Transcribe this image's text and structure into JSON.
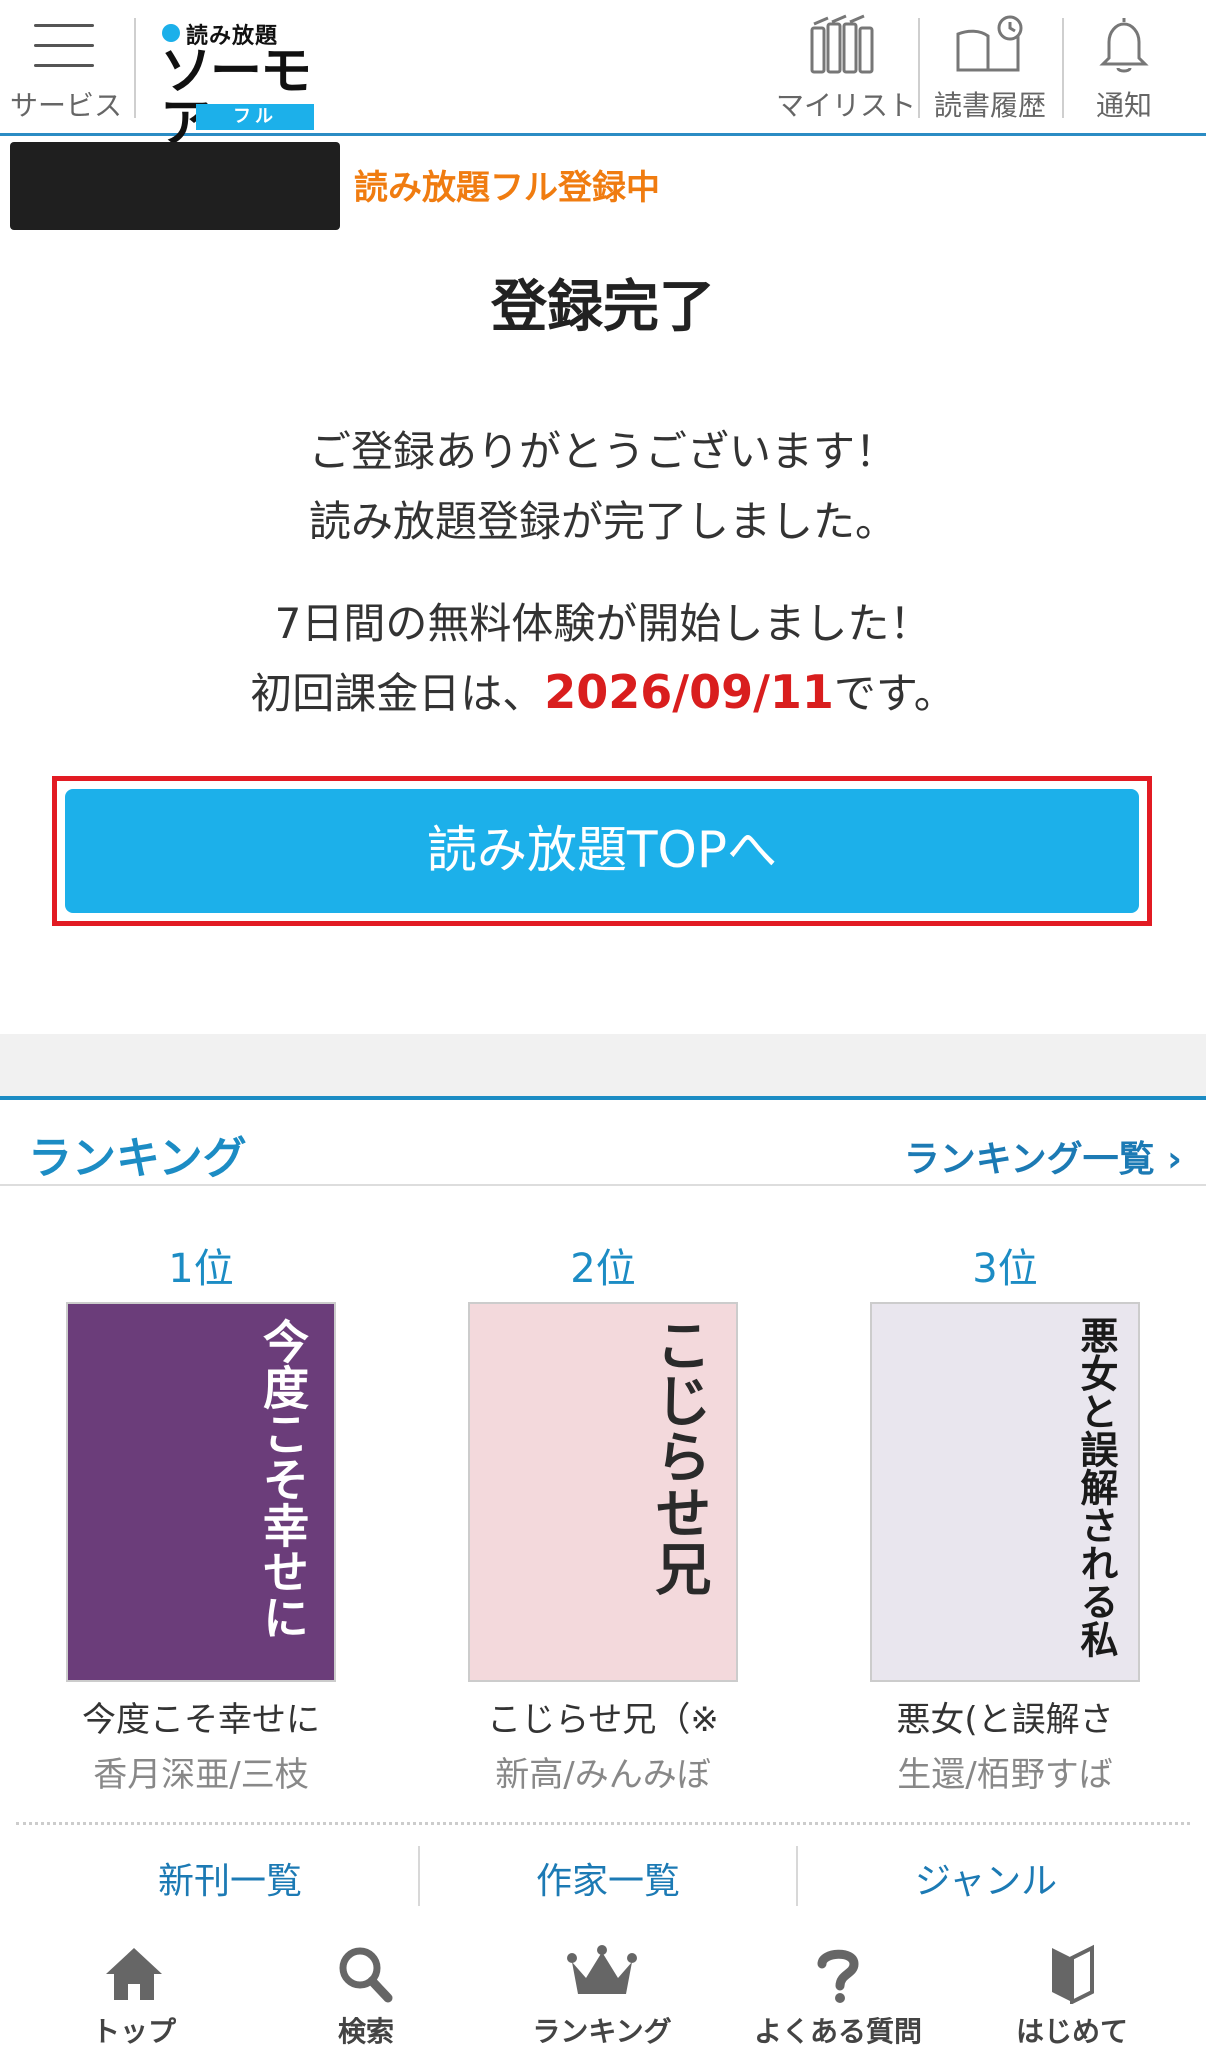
{
  "header": {
    "menu_label": "サービス",
    "logo_sub": "読み放題",
    "logo_main": "ソーモア",
    "logo_pill": "フル",
    "mylist_label": "マイリスト",
    "history_label": "読書履歴",
    "notify_label": "通知"
  },
  "status_text": "読み放題フル登録中",
  "completion": {
    "title": "登録完了",
    "thanks_line1": "ご登録ありがとうございます！",
    "thanks_line2": "読み放題登録が完了しました。",
    "trial_line": "7日間の無料体験が開始しました！",
    "billing_prefix": "初回課金日は、",
    "billing_date": "2026/09/11",
    "billing_suffix": "です。",
    "cta_label": "読み放題TOPへ"
  },
  "ranking": {
    "heading": "ランキング",
    "more_link": "ランキング一覧 ›",
    "items": [
      {
        "rank": "1位",
        "title": "今度こそ幸せに",
        "author": "香月深亜/三枝",
        "cover_text": "今度こそ幸せに",
        "cover_bg": "#6b3d7a",
        "cover_fg": "#ffffff"
      },
      {
        "rank": "2位",
        "title": "こじらせ兄（※",
        "author": "新高/みんみぼ",
        "cover_text": "こじらせ兄",
        "cover_bg": "#f3d9dc",
        "cover_fg": "#2a2a2a"
      },
      {
        "rank": "3位",
        "title": "悪女(と誤解さ",
        "author": "生還/栢野すば",
        "cover_text": "悪女と誤解される私",
        "cover_bg": "#e9e6ee",
        "cover_fg": "#1a1a1a"
      }
    ]
  },
  "sublinks": [
    "新刊一覧",
    "作家一覧",
    "ジャンル"
  ],
  "bottom_nav": {
    "top": "トップ",
    "search": "検索",
    "ranking": "ランキング",
    "faq": "よくある質問",
    "start": "はじめて"
  },
  "colors": {
    "accent": "#1cb0ea",
    "link": "#1c8cc4",
    "status_orange": "#f07c10",
    "date_red": "#d91e1e",
    "highlight_border": "#e21b23"
  }
}
